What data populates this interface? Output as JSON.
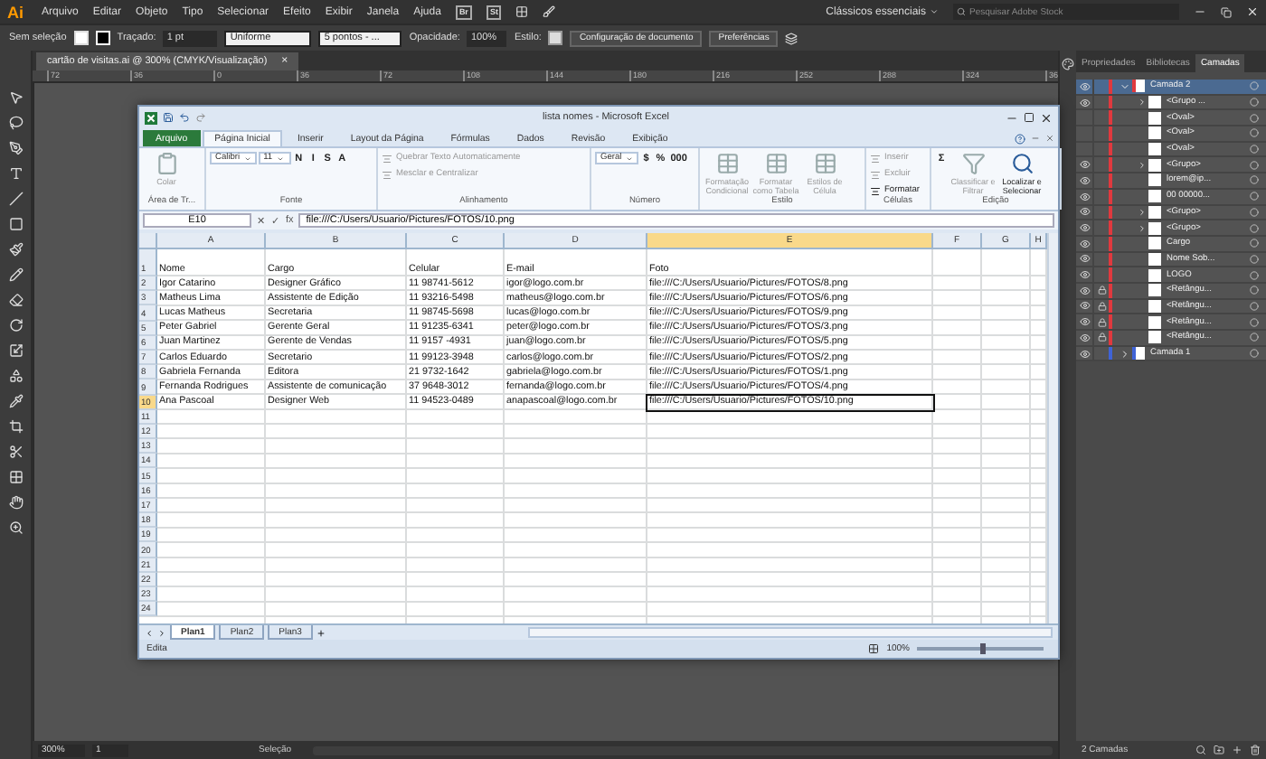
{
  "app_menu": {
    "logo": "Ai",
    "items": [
      "Arquivo",
      "Editar",
      "Objeto",
      "Tipo",
      "Selecionar",
      "Efeito",
      "Exibir",
      "Janela",
      "Ajuda"
    ],
    "badges": [
      "Br",
      "St"
    ],
    "workspace": "Clássicos essenciais",
    "search": {
      "placeholder": "Pesquisar Adobe Stock"
    }
  },
  "control_bar": {
    "selection": "Sem seleção",
    "stroke_label": "Traçado:",
    "stroke_weight": "1 pt",
    "profile": "Uniforme",
    "brush": "5 pontos - ...",
    "opacity_label": "Opacidade:",
    "opacity": "100%",
    "style_label": "Estilo:",
    "buttons": [
      "Configuração de documento",
      "Preferências"
    ]
  },
  "document_tab": {
    "title": "cartão de visitas.ai @ 300% (CMYK/Visualização)",
    "close": "×"
  },
  "ruler_ticks": [
    "72",
    "36",
    "0",
    "36",
    "72",
    "108",
    "144",
    "180",
    "216",
    "252",
    "288",
    "324",
    "36"
  ],
  "excel": {
    "title": "lista nomes - Microsoft Excel",
    "tabs": [
      {
        "label": "Arquivo",
        "kind": "file",
        "selected": false
      },
      {
        "label": "Página Inicial",
        "kind": "tab",
        "selected": true
      },
      {
        "label": "Inserir",
        "kind": "tab",
        "selected": false
      },
      {
        "label": "Layout da Página",
        "kind": "tab",
        "selected": false
      },
      {
        "label": "Fórmulas",
        "kind": "tab",
        "selected": false
      },
      {
        "label": "Dados",
        "kind": "tab",
        "selected": false
      },
      {
        "label": "Revisão",
        "kind": "tab",
        "selected": false
      },
      {
        "label": "Exibição",
        "kind": "tab",
        "selected": false
      }
    ],
    "ribbon": [
      {
        "label": "Área de Tr...",
        "items": [
          {
            "kind": "big",
            "label": "Colar",
            "disabled": true
          }
        ]
      },
      {
        "label": "Fonte",
        "items": [
          {
            "kind": "field",
            "value": "Calibri"
          },
          {
            "kind": "field",
            "value": "11"
          },
          {
            "kind": "glyph",
            "value": "N"
          },
          {
            "kind": "glyph",
            "value": "I"
          },
          {
            "kind": "glyph",
            "value": "S"
          },
          {
            "kind": "glyph",
            "value": "A"
          }
        ]
      },
      {
        "label": "Alinhamento",
        "items": [
          {
            "kind": "small",
            "label": "Quebrar Texto Automaticamente",
            "disabled": true
          },
          {
            "kind": "small",
            "label": "Mesclar e Centralizar",
            "disabled": true
          }
        ]
      },
      {
        "label": "Número",
        "items": [
          {
            "kind": "field",
            "value": "Geral"
          },
          {
            "kind": "glyph",
            "value": "$"
          },
          {
            "kind": "glyph",
            "value": "%"
          },
          {
            "kind": "glyph",
            "value": "000"
          }
        ]
      },
      {
        "label": "Estilo",
        "items": [
          {
            "kind": "big",
            "label": "Formatação Condicional",
            "disabled": true
          },
          {
            "kind": "big",
            "label": "Formatar como Tabela",
            "disabled": true
          },
          {
            "kind": "big",
            "label": "Estilos de Célula",
            "disabled": true
          }
        ]
      },
      {
        "label": "Células",
        "items": [
          {
            "kind": "small",
            "label": "Inserir",
            "disabled": true
          },
          {
            "kind": "small",
            "label": "Excluir",
            "disabled": true
          },
          {
            "kind": "small",
            "label": "Formatar",
            "disabled": false
          }
        ]
      },
      {
        "label": "Edição",
        "items": [
          {
            "kind": "glyph",
            "value": "Σ"
          },
          {
            "kind": "big",
            "label": "Classificar e Filtrar",
            "disabled": true
          },
          {
            "kind": "big",
            "label": "Localizar e Selecionar",
            "disabled": false
          }
        ]
      }
    ],
    "formula_bar": {
      "name_box": "E10",
      "buttons": [
        "✕",
        "✓",
        "fx"
      ],
      "value": "file:///C:/Users/Usuario/Pictures/FOTOS/10.png"
    },
    "columns": [
      {
        "label": "A",
        "selected": false
      },
      {
        "label": "B",
        "selected": false
      },
      {
        "label": "C",
        "selected": false
      },
      {
        "label": "D",
        "selected": false
      },
      {
        "label": "E",
        "selected": true
      },
      {
        "label": "F",
        "selected": false
      },
      {
        "label": "G",
        "selected": false
      },
      {
        "label": "H",
        "selected": false
      }
    ],
    "rows": [
      {
        "number": "1",
        "selected": false,
        "cells": [
          "Nome",
          "Cargo",
          "Celular",
          "E-mail",
          "Foto"
        ]
      },
      {
        "number": "2",
        "selected": false,
        "cells": [
          "Igor Catarino",
          "Designer Gráfico",
          "11 98741-5612",
          "igor@logo.com.br",
          "file:///C:/Users/Usuario/Pictures/FOTOS/8.png"
        ]
      },
      {
        "number": "3",
        "selected": false,
        "cells": [
          "Matheus Lima",
          "Assistente de Edição",
          "11 93216-5498",
          "matheus@logo.com.br",
          "file:///C:/Users/Usuario/Pictures/FOTOS/6.png"
        ]
      },
      {
        "number": "4",
        "selected": false,
        "cells": [
          "Lucas Matheus",
          "Secretaria",
          "11 98745-5698",
          "lucas@logo.com.br",
          "file:///C:/Users/Usuario/Pictures/FOTOS/9.png"
        ]
      },
      {
        "number": "5",
        "selected": false,
        "cells": [
          "Peter Gabriel",
          "Gerente Geral",
          "11 91235-6341",
          "peter@logo.com.br",
          "file:///C:/Users/Usuario/Pictures/FOTOS/3.png"
        ]
      },
      {
        "number": "6",
        "selected": false,
        "cells": [
          "Juan Martinez",
          "Gerente de Vendas",
          "11 9157 -4931",
          "juan@logo.com.br",
          "file:///C:/Users/Usuario/Pictures/FOTOS/5.png"
        ]
      },
      {
        "number": "7",
        "selected": false,
        "cells": [
          "Carlos Eduardo",
          "Secretario",
          "11 99123-3948",
          "carlos@logo.com.br",
          "file:///C:/Users/Usuario/Pictures/FOTOS/2.png"
        ]
      },
      {
        "number": "8",
        "selected": false,
        "cells": [
          "Gabriela Fernanda",
          "Editora",
          "21 9732-1642",
          "gabriela@logo.com.br",
          "file:///C:/Users/Usuario/Pictures/FOTOS/1.png"
        ]
      },
      {
        "number": "9",
        "selected": false,
        "cells": [
          "Fernanda Rodrigues",
          "Assistente de comunicação",
          "37 9648-3012",
          "fernanda@logo.com.br",
          "file:///C:/Users/Usuario/Pictures/FOTOS/4.png"
        ]
      },
      {
        "number": "10",
        "selected": true,
        "cells": [
          "Ana Pascoal",
          "Designer Web",
          "11 94523-0489",
          "anapascoal@logo.com.br",
          "file:///C:/Users/Usuario/Pictures/FOTOS/10.png"
        ]
      },
      {
        "number": "11",
        "selected": false
      },
      {
        "number": "12",
        "selected": false
      },
      {
        "number": "13",
        "selected": false
      },
      {
        "number": "14",
        "selected": false
      },
      {
        "number": "15",
        "selected": false
      },
      {
        "number": "16",
        "selected": false
      },
      {
        "number": "17",
        "selected": false
      },
      {
        "number": "18",
        "selected": false
      },
      {
        "number": "19",
        "selected": false
      },
      {
        "number": "20",
        "selected": false
      },
      {
        "number": "21",
        "selected": false
      },
      {
        "number": "22",
        "selected": false
      },
      {
        "number": "23",
        "selected": false
      },
      {
        "number": "24",
        "selected": false
      }
    ],
    "sheet_tabs": [
      {
        "label": "Plan1",
        "selected": true
      },
      {
        "label": "Plan2",
        "selected": false
      },
      {
        "label": "Plan3",
        "selected": false
      }
    ],
    "status": "Edita",
    "zoom": "100%",
    "zoom_slider": {
      "level": 0.5
    }
  },
  "panel": {
    "tabs": [
      {
        "label": "Propriedades",
        "selected": false
      },
      {
        "label": "Bibliotecas",
        "selected": false
      },
      {
        "label": "Camadas",
        "selected": true
      }
    ],
    "layers": [
      {
        "name": "Camada 2",
        "kind": "layer",
        "color": "#e0393e",
        "expanded": true,
        "selected": true,
        "visible": true,
        "locked": false,
        "children": [
          {
            "name": "<Grupo ...",
            "kind": "group",
            "selected": false,
            "visible": true,
            "locked": false
          },
          {
            "name": "<Oval>",
            "kind": "item",
            "selected": false,
            "visible": false,
            "locked": false
          },
          {
            "name": "<Oval>",
            "kind": "item",
            "selected": false,
            "visible": false,
            "locked": false
          },
          {
            "name": "<Oval>",
            "kind": "item",
            "selected": false,
            "visible": false,
            "locked": false
          },
          {
            "name": "<Grupo>",
            "kind": "group",
            "selected": false,
            "visible": true,
            "locked": false
          },
          {
            "name": "lorem@ip...",
            "kind": "item",
            "selected": false,
            "visible": true,
            "locked": false
          },
          {
            "name": "00 00000...",
            "kind": "item",
            "selected": false,
            "visible": true,
            "locked": false
          },
          {
            "name": "<Grupo>",
            "kind": "group",
            "selected": false,
            "visible": true,
            "locked": false
          },
          {
            "name": "<Grupo>",
            "kind": "group",
            "selected": false,
            "visible": true,
            "locked": false
          },
          {
            "name": "Cargo",
            "kind": "item",
            "selected": false,
            "visible": true,
            "locked": false
          },
          {
            "name": "Nome Sob...",
            "kind": "item",
            "selected": false,
            "visible": true,
            "locked": false
          },
          {
            "name": "LOGO",
            "kind": "item",
            "selected": false,
            "visible": true,
            "locked": false
          },
          {
            "name": "<Retângu...",
            "kind": "item",
            "selected": false,
            "visible": true,
            "locked": true
          },
          {
            "name": "<Retângu...",
            "kind": "item",
            "selected": false,
            "visible": true,
            "locked": true
          },
          {
            "name": "<Retângu...",
            "kind": "item",
            "selected": false,
            "visible": true,
            "locked": true
          },
          {
            "name": "<Retângu...",
            "kind": "item",
            "selected": false,
            "visible": true,
            "locked": true
          }
        ]
      },
      {
        "name": "Camada 1",
        "kind": "layer",
        "color": "#3f63d6",
        "expanded": false,
        "selected": false,
        "visible": true,
        "locked": false
      }
    ],
    "footer": "2 Camadas"
  },
  "status_bar": {
    "zoom": "300%",
    "artboard": "1",
    "tool": "Seleção"
  }
}
